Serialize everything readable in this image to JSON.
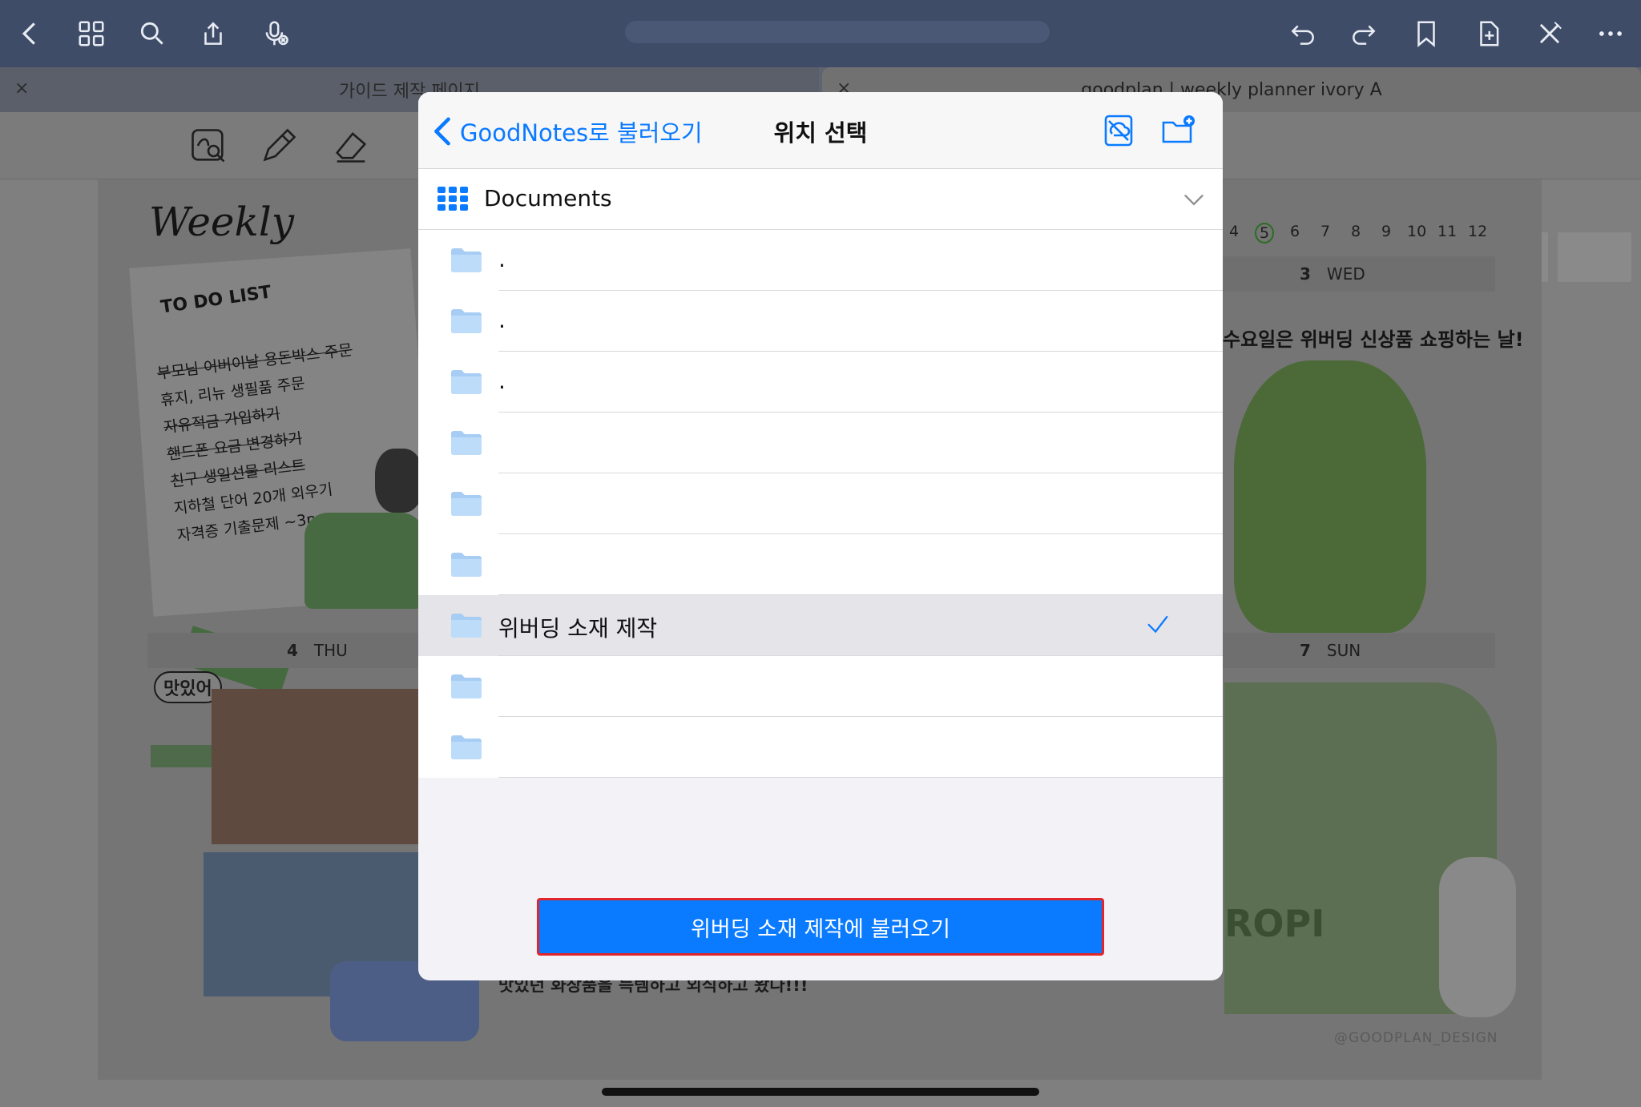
{
  "toolbar": {
    "icons": [
      "back-icon",
      "grid-icon",
      "search-icon",
      "share-icon",
      "mic-off-icon",
      "undo-icon",
      "redo-icon",
      "bookmark-icon",
      "add-page-icon",
      "close-tools-icon",
      "more-icon"
    ]
  },
  "tabs": {
    "left": "가이드 제작 페이지",
    "right": "goodplan | weekly planner ivory A",
    "close_symbol": "×"
  },
  "planner": {
    "title": "Weekly",
    "todo_title": "TO DO LIST",
    "todo_items": [
      {
        "text": "부모님 어버이날 용돈박스 주문",
        "done": true
      },
      {
        "text": "휴지, 리뉴 생필품 주문",
        "done": false
      },
      {
        "text": "자유적금 가입하기",
        "done": true
      },
      {
        "text": "핸드폰 요금 변경하기",
        "done": true
      },
      {
        "text": "친구 생일선물 리스트",
        "done": true
      },
      {
        "text": "지하철 단어 20개 외우기",
        "done": false
      },
      {
        "text": "자격증 기출문제 ~3p",
        "done": false
      }
    ],
    "dates": [
      "4",
      "5",
      "6",
      "7",
      "8",
      "9",
      "10",
      "11",
      "12"
    ],
    "highlighted_date": "5",
    "day_wed": {
      "num": "3",
      "name": "WED"
    },
    "day_thu": {
      "num": "4",
      "name": "THU"
    },
    "day_sun": {
      "num": "7",
      "name": "SUN"
    },
    "wed_note": "수요일은 위버딩 신상품 쇼핑하는 날!",
    "thu_sticker": "맛있어",
    "sun_sticker": "ROPI",
    "bottom_note": "맛있던 화장품을 득템하고 외식하고 왔다!!!",
    "credit": "@GOODPLAN_DESIGN"
  },
  "modal": {
    "back_label": "GoodNotes로 불러오기",
    "title": "위치 선택",
    "location": "Documents",
    "folders": [
      {
        "name": ".",
        "selected": false
      },
      {
        "name": ".",
        "selected": false
      },
      {
        "name": ".",
        "selected": false
      },
      {
        "name": "",
        "selected": false
      },
      {
        "name": "",
        "selected": false
      },
      {
        "name": "",
        "selected": false
      },
      {
        "name": "위버딩 소재 제작",
        "selected": true
      },
      {
        "name": "",
        "selected": false
      },
      {
        "name": "",
        "selected": false
      }
    ],
    "import_button": "위버딩 소재 제작에 불러오기"
  },
  "colors": {
    "accent": "#0a7aff",
    "toolbar_bg": "#3f4c68",
    "highlight_border": "#e0252b"
  }
}
